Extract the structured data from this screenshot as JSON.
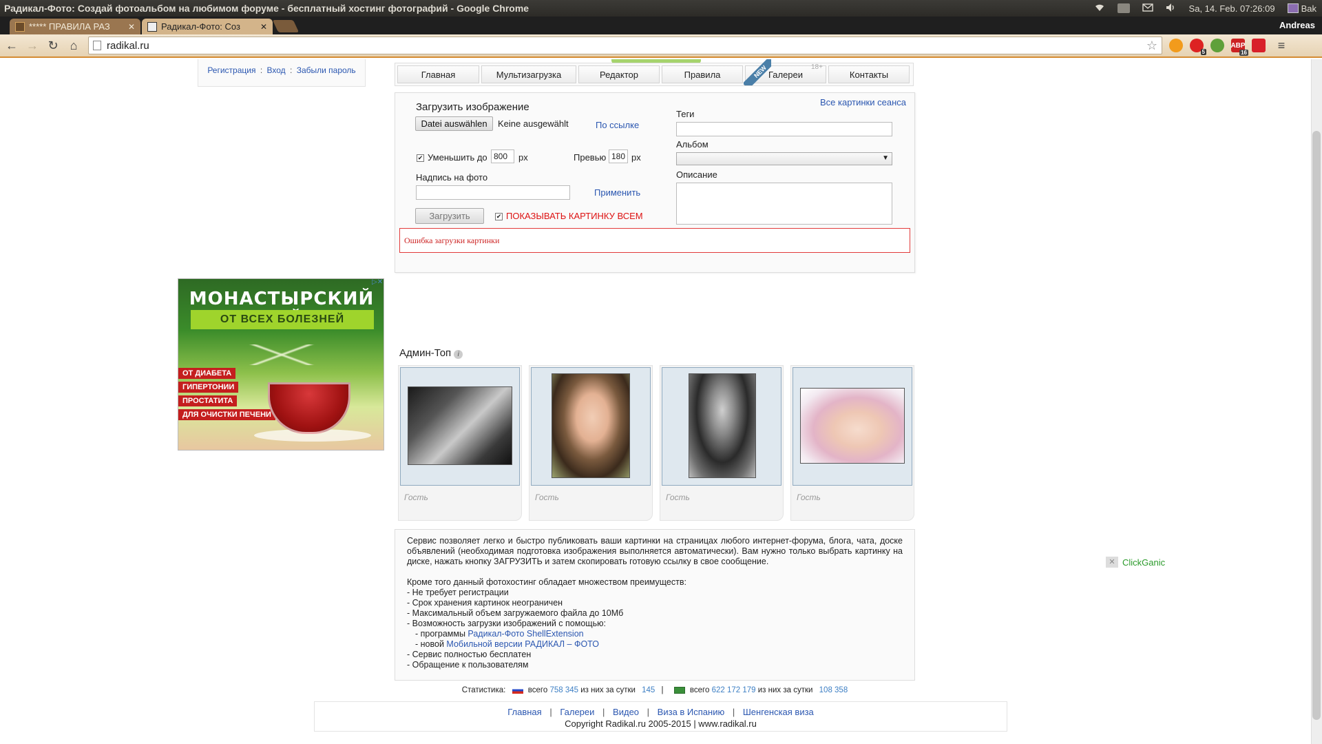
{
  "os": {
    "window_title": "Радикал-Фото: Создай фотоальбом на любимом форуме - бесплатный хостинг фотографий - Google Chrome",
    "datetime": "Sa, 14. Feb. 07:26:09",
    "user_short": "Bak"
  },
  "browser": {
    "tabs": [
      {
        "label": "***** ПРАВИЛА РАЗ",
        "active": false
      },
      {
        "label": "Радикал-Фото: Соз",
        "active": true
      }
    ],
    "profile_name": "Andreas",
    "url": "radikal.ru",
    "ext_badges": {
      "a": "5",
      "abp": "16"
    }
  },
  "login": {
    "register": "Регистрация",
    "login": "Вход",
    "forgot": "Забыли пароль",
    "sep": ":"
  },
  "nav": {
    "items": [
      "Главная",
      "Мультизагрузка",
      "Редактор",
      "Правила",
      "Галереи",
      "Контакты"
    ],
    "new_label": "NEW",
    "age_label": "18+"
  },
  "upload": {
    "title": "Загрузить изображение",
    "file_button": "Datei auswählen",
    "file_status": "Keine ausgewählt",
    "by_link": "По ссылке",
    "all_session": "Все картинки сеанса",
    "reduce_label": "Уменьшить до",
    "reduce_value": "800",
    "px": "px",
    "preview_label": "Превью",
    "preview_value": "180",
    "caption_label": "Надпись на фото",
    "caption_value": "",
    "apply": "Применить",
    "submit": "Загрузить",
    "show_all": "ПОКАЗЫВАТЬ КАРТИНКУ ВСЕМ",
    "tags_label": "Теги",
    "album_label": "Альбом",
    "description_label": "Описание",
    "error": "Ошибка загрузки картинки",
    "check_mark": "✔"
  },
  "ad": {
    "line1": "МОНАСТЫРСКИЙ ЧАЙ",
    "line2": "ОТ ВСЕХ БОЛЕЗНЕЙ",
    "tags": [
      "ОТ ДИАБЕТА",
      "ГИПЕРТОНИИ",
      "ПРОСТАТИТА",
      "ДЛЯ ОЧИСТКИ ПЕЧЕНИ"
    ]
  },
  "admin_top": {
    "title": "Админ-Топ",
    "info": "i",
    "cards": [
      {
        "author": "Гость"
      },
      {
        "author": "Гость"
      },
      {
        "author": "Гость"
      },
      {
        "author": "Гость"
      }
    ]
  },
  "description": {
    "p1": "Сервис позволяет легко и быстро публиковать ваши картинки на страницах любого интернет-форума, блога, чата, доске объявлений (необходимая подготовка изображения выполняется автоматически). Вам нужно только выбрать картинку на диске, нажать кнопку ЗАГРУЗИТЬ и затем скопировать готовую ссылку в свое сообщение.",
    "p2": "Кроме того данный фотохостинг обладает множеством преимуществ:",
    "l1": "- Не требует регистрации",
    "l2": "- Срок хранения картинок неограничен",
    "l3": "- Максимальный объем загружаемого файла до 10Мб",
    "l4": "- Возможность загрузки изображений с помощью:",
    "l5_prefix": "- программы ",
    "l5_link": "Радикал-Фото ShellExtension",
    "l6_prefix": "- новой ",
    "l6_link": "Мобильной версии РАДИКАЛ – ФОТО",
    "l7": "- Сервис полностью бесплатен",
    "l8": "- Обращение к пользователям"
  },
  "stats": {
    "label": "Статистика:",
    "total_word": "всего",
    "per_day_word": "из них за сутки",
    "sep": "|",
    "ru_total": "758 345",
    "ru_day": "145",
    "other_total": "622 172 179",
    "other_day": "108 358"
  },
  "footer": {
    "links": [
      "Главная",
      "Галереи",
      "Видео",
      "Виза в Испанию",
      "Шенгенская виза"
    ],
    "sep": "|",
    "copyright": "Copyright Radikal.ru 2005-2015 | www.radikal.ru"
  },
  "clickganic": {
    "close": "✕",
    "label": "ClickGanic"
  }
}
